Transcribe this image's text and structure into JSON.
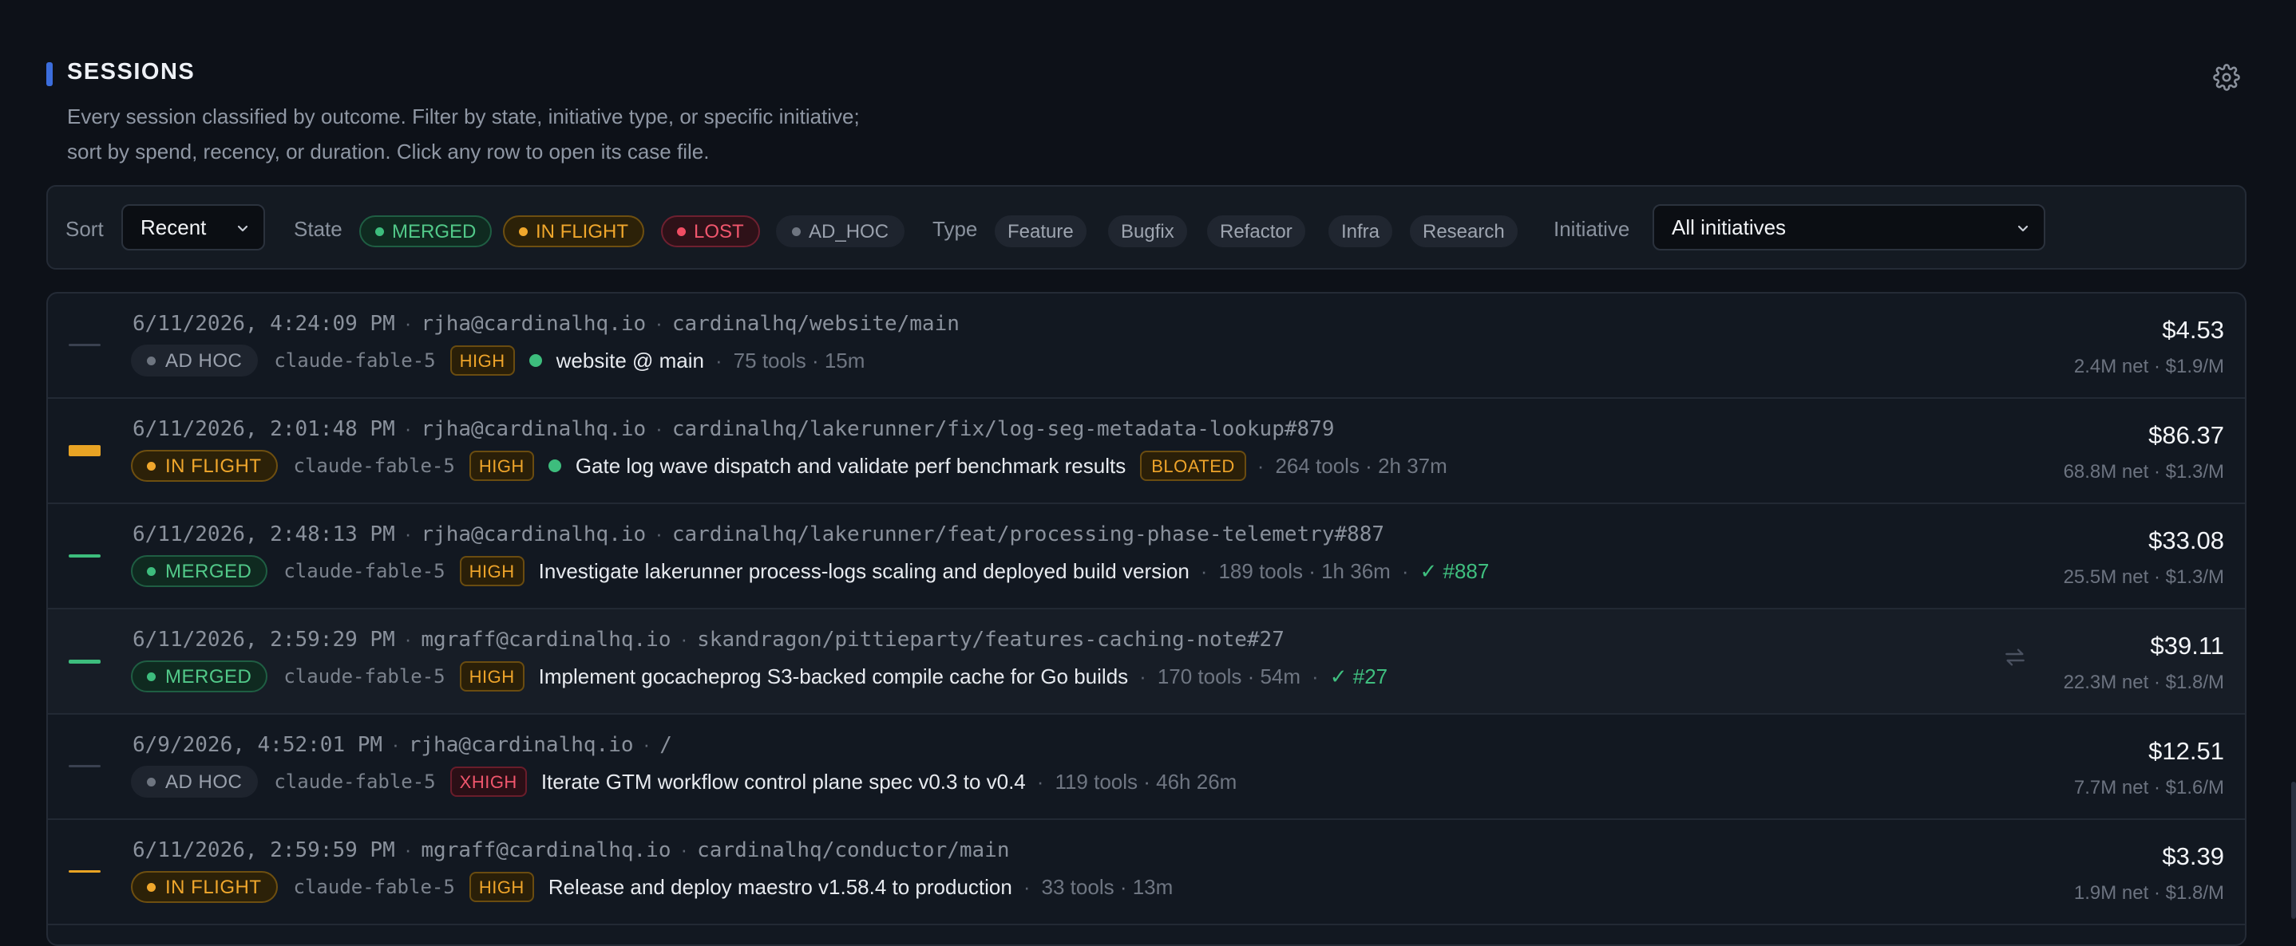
{
  "section": {
    "title": "SESSIONS",
    "description_line1": "Every session classified by outcome. Filter by state, initiative type, or specific initiative;",
    "description_line2": "sort by spend, recency, or duration. Click any row to open its case file."
  },
  "filters": {
    "sort_label": "Sort",
    "sort_value": "Recent",
    "state_label": "State",
    "states": [
      "MERGED",
      "IN FLIGHT",
      "LOST",
      "AD_HOC"
    ],
    "type_label": "Type",
    "types": [
      "Feature",
      "Bugfix",
      "Refactor",
      "Infra",
      "Research"
    ],
    "initiative_label": "Initiative",
    "initiative_value": "All initiatives"
  },
  "colors": {
    "merged": "#3dbd7d",
    "in_flight": "#f0a72c",
    "lost": "#ef4d63",
    "ad_hoc": "#6e7580",
    "accent": "#3b6ddc"
  },
  "sessions": [
    {
      "timestamp": "6/11/2026, 4:24:09 PM",
      "user": "rjha@cardinalhq.io",
      "ref": "cardinalhq/website/main",
      "state": "AD HOC",
      "model": "claude-fable-5",
      "priority": "HIGH",
      "title": "website @ main",
      "stats": "75 tools · 15m",
      "cost": "$4.53",
      "net": "2.4M net · $1.9/M"
    },
    {
      "timestamp": "6/11/2026, 2:01:48 PM",
      "user": "rjha@cardinalhq.io",
      "ref": "cardinalhq/lakerunner/fix/log-seg-metadata-lookup#879",
      "state": "IN FLIGHT",
      "model": "claude-fable-5",
      "priority": "HIGH",
      "title": "Gate log wave dispatch and validate perf benchmark results",
      "flag": "BLOATED",
      "stats": "264 tools · 2h 37m",
      "cost": "$86.37",
      "net": "68.8M net · $1.3/M"
    },
    {
      "timestamp": "6/11/2026, 2:48:13 PM",
      "user": "rjha@cardinalhq.io",
      "ref": "cardinalhq/lakerunner/feat/processing-phase-telemetry#887",
      "state": "MERGED",
      "model": "claude-fable-5",
      "priority": "HIGH",
      "title": "Investigate lakerunner process-logs scaling and deployed build version",
      "stats": "189 tools · 1h 36m",
      "pr": "✓ #887",
      "cost": "$33.08",
      "net": "25.5M net · $1.3/M"
    },
    {
      "timestamp": "6/11/2026, 2:59:29 PM",
      "user": "mgraff@cardinalhq.io",
      "ref": "skandragon/pittieparty/features-caching-note#27",
      "state": "MERGED",
      "model": "claude-fable-5",
      "priority": "HIGH",
      "title": "Implement gocacheprog S3-backed compile cache for Go builds",
      "stats": "170 tools · 54m",
      "pr": "✓ #27",
      "cost": "$39.11",
      "net": "22.3M net · $1.8/M"
    },
    {
      "timestamp": "6/9/2026, 4:52:01 PM",
      "user": "rjha@cardinalhq.io",
      "ref": "/",
      "state": "AD HOC",
      "model": "claude-fable-5",
      "priority": "XHIGH",
      "title": "Iterate GTM workflow control plane spec v0.3 to v0.4",
      "stats": "119 tools · 46h 26m",
      "cost": "$12.51",
      "net": "7.7M net · $1.6/M"
    },
    {
      "timestamp": "6/11/2026, 2:59:59 PM",
      "user": "mgraff@cardinalhq.io",
      "ref": "cardinalhq/conductor/main",
      "state": "IN FLIGHT",
      "model": "claude-fable-5",
      "priority": "HIGH",
      "title": "Release and deploy maestro v1.58.4 to production",
      "stats": "33 tools · 13m",
      "cost": "$3.39",
      "net": "1.9M net · $1.8/M"
    }
  ]
}
